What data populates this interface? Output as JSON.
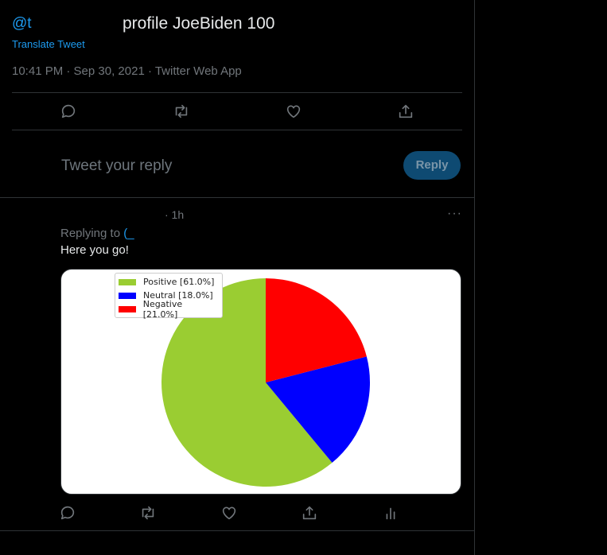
{
  "tweet": {
    "handle": "@t",
    "text": "profile JoeBiden 100",
    "translate_label": "Translate Tweet",
    "meta": "10:41 PM · Sep 30, 2021 · Twitter Web App"
  },
  "actions": {
    "icons": [
      "reply-icon",
      "retweet-icon",
      "like-icon",
      "share-icon"
    ]
  },
  "composer": {
    "placeholder": "Tweet your reply",
    "reply_label": "Reply"
  },
  "reply": {
    "time": "· 1h",
    "more": "···",
    "replying_to_label": "Replying to",
    "replying_to_handle": "(_",
    "text": "Here you go!"
  },
  "reply_actions": {
    "icons": [
      "reply-icon",
      "retweet-icon",
      "like-icon",
      "share-icon",
      "analytics-icon"
    ]
  },
  "colors": {
    "accent": "#1d9bf0",
    "positive": "#9acd32",
    "neutral": "#0000ff",
    "negative": "#ff0000"
  },
  "chart_data": {
    "type": "pie",
    "title": "",
    "legend_position": "top-left",
    "slices": [
      {
        "label": "Positive [61.0%]",
        "value": 61.0,
        "color": "#9acd32"
      },
      {
        "label": "Neutral [18.0%]",
        "value": 18.0,
        "color": "#0000ff"
      },
      {
        "label": "Negative [21.0%]",
        "value": 21.0,
        "color": "#ff0000"
      }
    ]
  }
}
